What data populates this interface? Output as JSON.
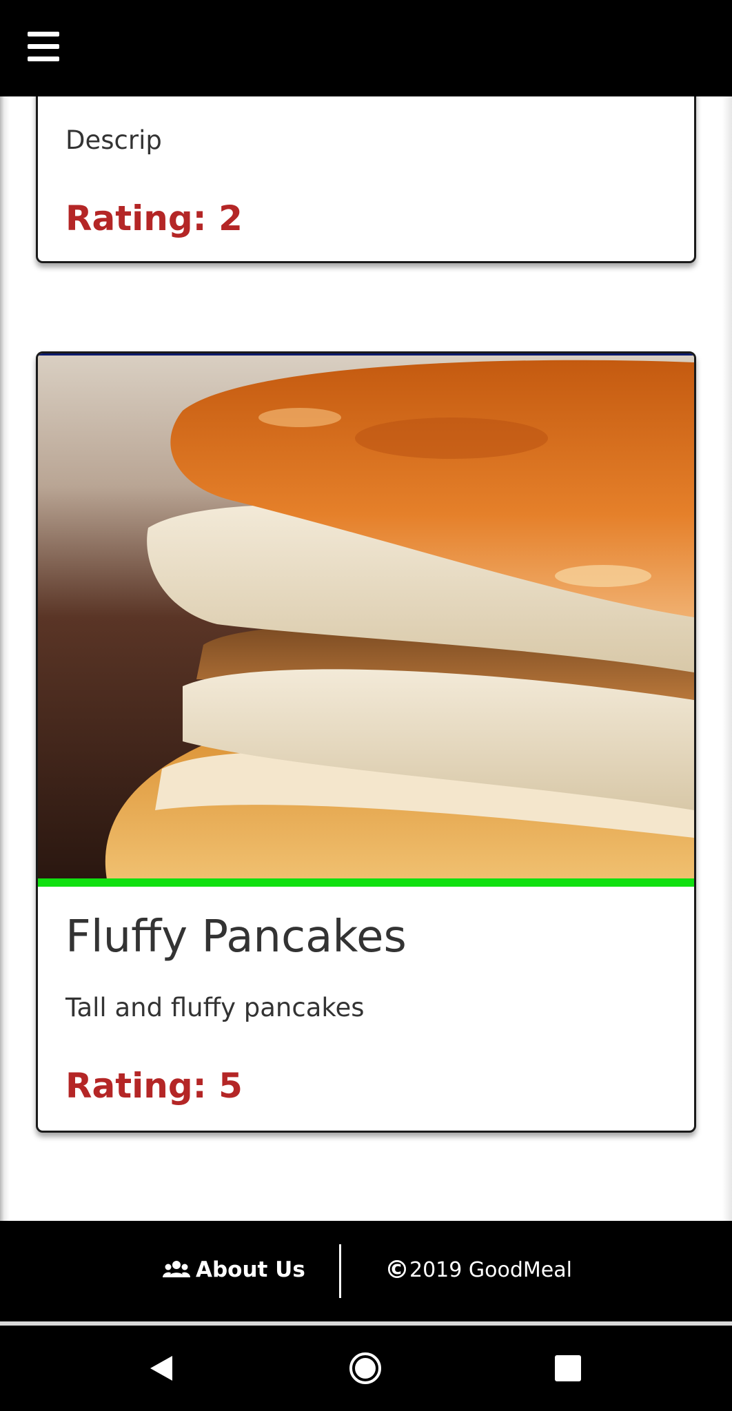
{
  "header": {
    "menu_icon": "hamburger-menu-icon"
  },
  "recipes": [
    {
      "description": "Descrip",
      "rating": "Rating: 2"
    },
    {
      "image_icon": "pancakes-photo",
      "title": "Fluffy Pancakes",
      "description": "Tall and fluffy pancakes",
      "rating": "Rating: 5"
    }
  ],
  "footer": {
    "about_label": "About Us",
    "about_icon": "users-icon",
    "copyright_symbol": "©",
    "copyright_text": "2019 GoodMeal"
  },
  "system_nav": {
    "back_icon": "back-triangle-icon",
    "home_icon": "home-circle-icon",
    "recents_icon": "recents-square-icon"
  },
  "colors": {
    "rating": "#b42626",
    "accent_bar": "#10e010",
    "bar_background": "#000000"
  }
}
